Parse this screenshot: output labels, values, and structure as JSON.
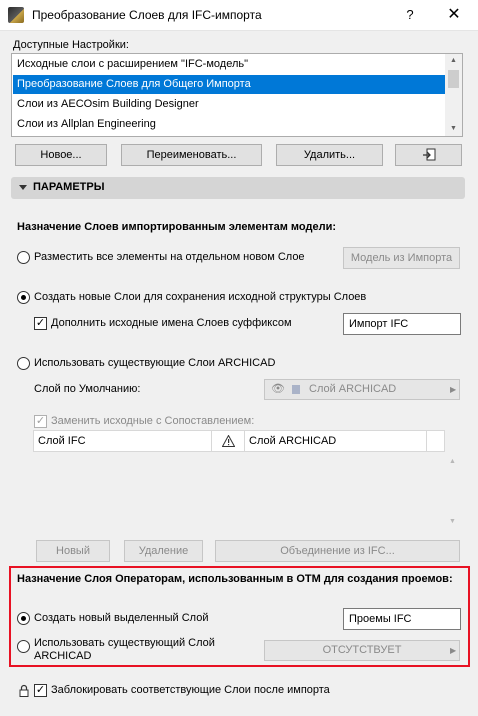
{
  "window": {
    "title": "Преобразование Слоев для IFC-импорта",
    "help": "?",
    "close": "✕"
  },
  "presets": {
    "label": "Доступные Настройки:",
    "items": [
      "Исходные слои с расширением \"IFC-модель\"",
      "Преобразование Слоев для Общего Импорта",
      "Слои из AECOsim Building Designer",
      "Слои из Allplan Engineering"
    ],
    "selected_index": 1
  },
  "preset_buttons": {
    "new": "Новое...",
    "rename": "Переименовать...",
    "delete": "Удалить...",
    "import_icon": "import-icon"
  },
  "section": {
    "title": "ПАРАМЕТРЫ"
  },
  "model_layers": {
    "heading": "Назначение Слоев импортированным элементам модели:",
    "option_single": "Разместить все элементы на отдельном новом Слое",
    "single_value": "Модель из Импорта",
    "option_new": "Создать новые Слои для сохранения исходной структуры Слоев",
    "suffix_label": "Дополнить исходные имена Слоев суффиксом",
    "suffix_value": "Импорт IFC",
    "option_existing": "Использовать существующие Слои ARCHICAD",
    "default_label": "Слой по Умолчанию:",
    "default_value": "Слой ARCHICAD",
    "replace_label": "Заменить исходные с Сопоставлением:",
    "table_col_ifc": "Слой IFC",
    "table_col_archicad": "Слой ARCHICAD",
    "btn_new": "Новый",
    "btn_delete": "Удаление",
    "btn_merge": "Объединение из IFC..."
  },
  "opening_layers": {
    "heading": "Назначение Слоя Операторам, использованным в ОТМ для создания проемов:",
    "option_new": "Создать новый выделенный Слой",
    "new_value": "Проемы IFC",
    "option_existing_line1": "Использовать существующий Слой",
    "option_existing_line2": "ARCHICAD",
    "existing_value": "ОТСУТСТВУЕТ"
  },
  "lock": {
    "label": "Заблокировать соответствующие Слои после импорта"
  },
  "colors": {
    "selection": "#0078d7",
    "highlight_frame": "#e81123"
  }
}
